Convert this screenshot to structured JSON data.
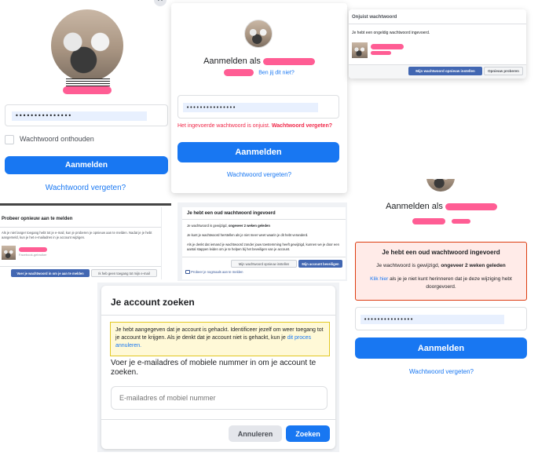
{
  "p1": {
    "password_mask": "•••••••••••••••",
    "remember_label": "Wachtwoord onthouden",
    "login_button": "Aanmelden",
    "forgot_link": "Wachtwoord vergeten?"
  },
  "p2": {
    "login_as": "Aanmelden als",
    "not_you": "Ben jij dit niet?",
    "password_mask": "•••••••••••••••",
    "error_text": "Het ingevoerde wachtwoord is onjuist.",
    "error_link": "Wachtwoord vergeten?",
    "login_button": "Aanmelden",
    "forgot_link": "Wachtwoord vergeten?"
  },
  "p3": {
    "title": "Onjuist wachtwoord",
    "body": "Je hebt een ongeldig wachtwoord ingevoerd.",
    "reset_button": "Mijn wachtwoord opnieuw instellen",
    "retry_button": "Opnieuw proberen"
  },
  "p4": {
    "title": "Probeer opnieuw aan te melden",
    "body": "Als je niet langer toegang hebt tot je e-mail, kun je proberen je opnieuw aan te melden. Nadat je je hebt aangemeld, kun je het e-mailadres in je account wijzigen.",
    "user_sub": "Facebook-gebruiker",
    "use_email_button": "Voer je wachtwoord in om je aan te melden",
    "no_access_button": "Ik heb geen toegang tot mijn e-mail"
  },
  "p5": {
    "title": "Je hebt een oud wachtwoord ingevoerd",
    "line1_pre": "Je wachtwoord is gewijzigd,",
    "line1_bold": "ongeveer 2 weken geleden",
    "line2": "Je kunt je wachtwoord herstellen als je niet meer weet waarin je dit hebt veranderd.",
    "line3": "Als je denkt dat iemand je wachtwoord zonder jouw toestemming heeft gewijzigd, kunnen we je door een aantal stappen leiden om je te helpen bij het beveiligen van je account.",
    "reset_button": "Mijn wachtwoord opnieuw instellen",
    "secure_button": "Mijn account beveiligen",
    "retry_link": "Probeer je nogmaals aan te melden"
  },
  "p6": {
    "title": "Je account zoeken",
    "notice_text": "Je hebt aangegeven dat je account is gehackt. Identificeer jezelf om weer toegang tot je account te krijgen. Als je denkt dat je account niet is gehackt, kun je",
    "notice_link": "dit proces annuleren.",
    "prompt": "Voer je e-mailadres of mobiele nummer in om je account te zoeken.",
    "input_placeholder": "E-mailadres of mobiel nummer",
    "cancel_button": "Annuleren",
    "search_button": "Zoeken"
  },
  "p7": {
    "login_as": "Aanmelden als",
    "alert_title": "Je hebt een oud wachtwoord ingevoerd",
    "alert_line1_pre": "Je wachtwoord is gewijzigd,",
    "alert_line1_bold": "ongeveer 2 weken geleden",
    "alert_link": "Klik hier",
    "alert_line2": "als je je niet kunt herinneren dat je deze wijziging hebt doorgevoerd.",
    "password_mask": "•••••••••••••••",
    "login_button": "Aanmelden",
    "forgot_link": "Wachtwoord vergeten?"
  },
  "colors": {
    "primary": "#1877f2",
    "redaction": "#ff4f8b",
    "error": "#f02849",
    "alert_bg": "#ffebe8",
    "alert_border": "#dd3c10",
    "notice_bg": "#fff9d7",
    "notice_border": "#e2c822"
  }
}
